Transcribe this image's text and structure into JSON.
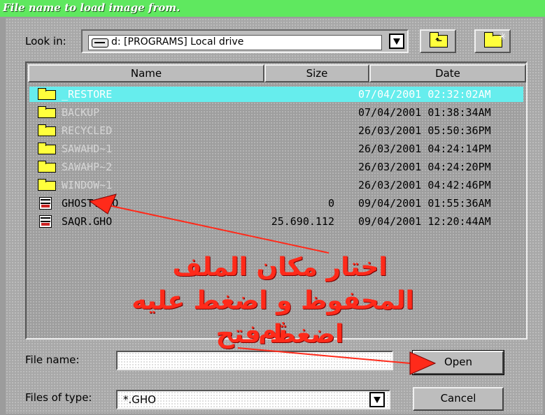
{
  "window": {
    "title": "File name to load image from."
  },
  "look_in": {
    "label": "Look in:",
    "value": "d: [PROGRAMS] Local drive"
  },
  "columns": {
    "name": "Name",
    "size": "Size",
    "date": "Date"
  },
  "files": [
    {
      "name": "_RESTORE",
      "size": "",
      "date": "07/04/2001 02:32:02AM",
      "kind": "folder",
      "selected": true
    },
    {
      "name": "BACKUP",
      "size": "",
      "date": "07/04/2001 01:38:34AM",
      "kind": "folder"
    },
    {
      "name": "RECYCLED",
      "size": "",
      "date": "26/03/2001 05:50:36PM",
      "kind": "folder"
    },
    {
      "name": "SAWAHD~1",
      "size": "",
      "date": "26/03/2001 04:24:14PM",
      "kind": "folder"
    },
    {
      "name": "SAWAHP~2",
      "size": "",
      "date": "26/03/2001 04:24:20PM",
      "kind": "folder"
    },
    {
      "name": "WINDOW~1",
      "size": "",
      "date": "26/03/2001 04:42:46PM",
      "kind": "folder"
    },
    {
      "name": "GHOST.GHO",
      "size": "0",
      "date": "09/04/2001 01:55:36AM",
      "kind": "file"
    },
    {
      "name": "SAQR.GHO",
      "size": "25.690.112",
      "date": "09/04/2001 12:20:44AM",
      "kind": "file"
    }
  ],
  "file_name": {
    "label": "File name:",
    "value": ""
  },
  "files_of_type": {
    "label": "Files of type:",
    "value": "*.GHO"
  },
  "buttons": {
    "open": "Open",
    "cancel": "Cancel"
  },
  "annotation": {
    "line1": "اختار مكان الملف",
    "line2": "المحفوظ و اضغط عليه ثم",
    "line3": "اضغط فتح",
    "color": "#ff2a1a"
  },
  "colors": {
    "titlebar": "#5fe85f",
    "selection": "#66eded",
    "folder": "#ffff3c"
  }
}
